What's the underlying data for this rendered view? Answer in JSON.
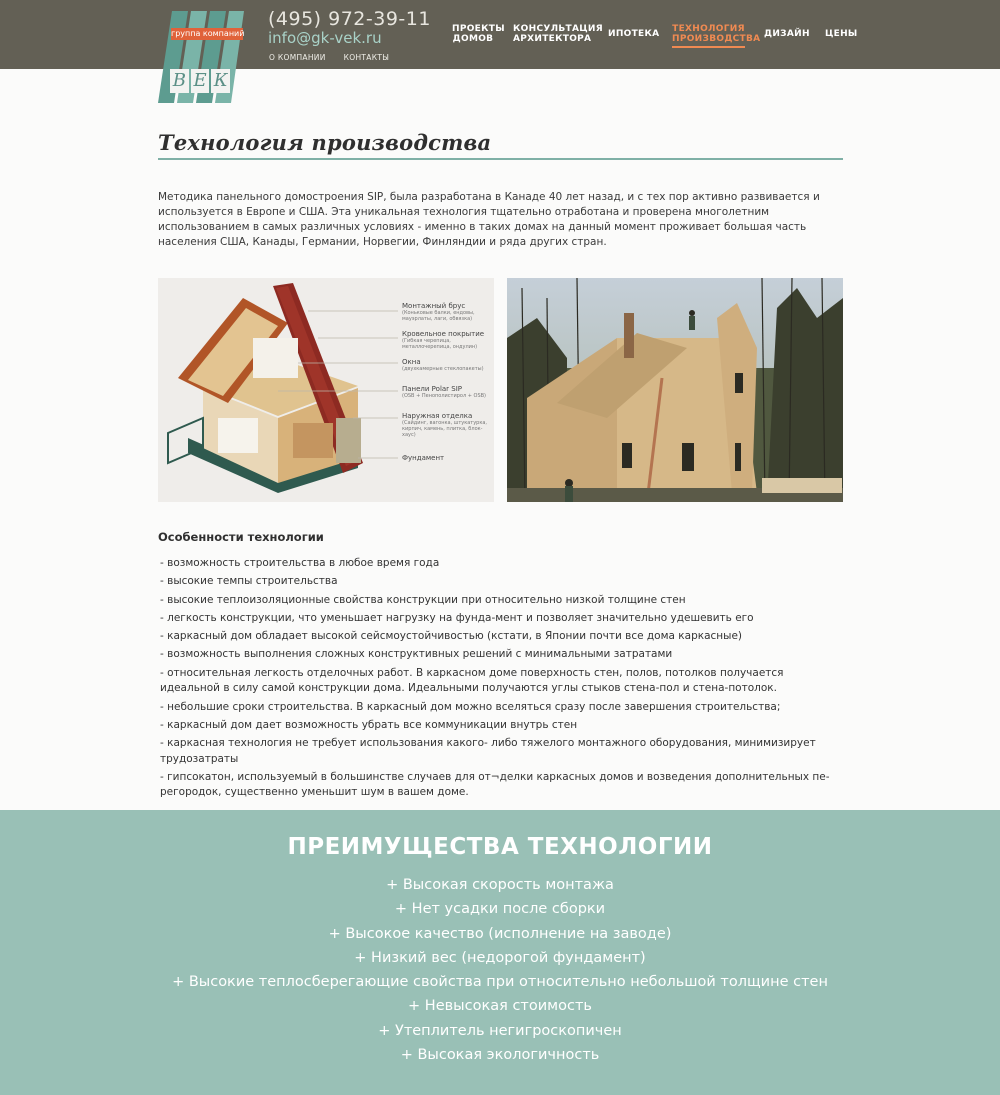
{
  "header": {
    "logo_tag": "группа компаний",
    "logo_letters": [
      "В",
      "Е",
      "К"
    ],
    "phone": "(495) 972-39-11",
    "email": "info@gk-vek.ru",
    "subnav": [
      "О КОМПАНИИ",
      "КОНТАКТЫ"
    ],
    "nav": [
      {
        "line1": "ПРОЕКТЫ",
        "line2": "ДОМОВ"
      },
      {
        "line1": "КОНСУЛЬТАЦИЯ",
        "line2": "АРХИТЕКТОРА"
      },
      {
        "line1": "ИПОТЕКА",
        "line2": ""
      },
      {
        "line1": "ТЕХНОЛОГИЯ",
        "line2": "ПРОИЗВОДСТВА"
      },
      {
        "line1": "ДИЗАЙН",
        "line2": ""
      },
      {
        "line1": "ЦЕНЫ",
        "line2": ""
      }
    ],
    "accent_color": "#f08a52",
    "bar_color": "#636055"
  },
  "page": {
    "title": "Технология производства",
    "intro": "Методика панельного домостроения SIP, была разработана в Канаде 40 лет назад, и с тех пор активно развивается и используется в Европе и США. Эта уникальная технология тщательно отработана и проверена многолетним использованием в самых различных условиях - именно в таких домах на данный момент проживает большая часть населения США, Канады, Германии, Норвегии, Финляндии и ряда других стран."
  },
  "diagram": {
    "labels": [
      {
        "title": "Монтажный брус",
        "sub": "(Коньковые балки, ендовы, мауэрлаты, лаги, обвязка)"
      },
      {
        "title": "Кровельное покрытие",
        "sub": "(Гибкая черепица, металлочерепица, ондулин)"
      },
      {
        "title": "Окна",
        "sub": "(двухкамерные стеклопакеты)"
      },
      {
        "title": "Панели Polar SIP",
        "sub": "(OSB + Пенополистирол + OSB)"
      },
      {
        "title": "Наружная отделка",
        "sub": "(Сайдинг, вагонка, штукатурка, кирпич, камень, плитка, блок-хаус)"
      },
      {
        "title": "Фундамент",
        "sub": ""
      }
    ]
  },
  "features": {
    "title": "Особенности технологии",
    "items": [
      "- возможность строительства в любое время года",
      "- высокие темпы строительства",
      "- высокие теплоизоляционные свойства конструкции при относительно низкой толщине стен",
      "- легкость конструкции, что уменьшает нагрузку на фунда-мент и позволяет значительно удешевить его",
      "- каркасный дом обладает высокой сейсмоустойчивостью (кстати, в Японии почти все дома каркасные)",
      "- возможность выполнения сложных конструктивных решений с минимальными затратами",
      "- относительная легкость отделочных работ. В каркасном доме поверхность стен, полов, потолков получается идеальной в силу самой конструкции дома. Идеальными получаются углы стыков стена-пол и стена-потолок.",
      "- небольшие сроки строительства. В каркасный дом можно вселяться сразу после завершения строительства;",
      "- каркасный дом дает возможность убрать все коммуникации внутрь стен",
      "- каркасная технология не требует использования какого- либо тяжелого монтажного оборудования, минимизирует трудозатраты",
      "- гипсокатон, используемый в большинстве случаев для от¬делки каркасных домов и возведения дополнительных пе-регородок, существенно уменьшит шум в вашем доме."
    ]
  },
  "benefits": {
    "title": "ПРЕИМУЩЕСТВА ТЕХНОЛОГИИ",
    "band_color": "#99c0b6",
    "items": [
      "+ Высокая скорость монтажа",
      "+ Нет усадки после сборки",
      "+ Высокое качество (исполнение на заводе)",
      "+ Низкий вес (недорогой фундамент)",
      "+ Высокие теплосберегающие свойства при относительно небольшой толщине стен",
      "+ Невысокая стоимость",
      "+ Утеплитель негигроскопичен",
      "+ Высокая экологичность"
    ]
  }
}
